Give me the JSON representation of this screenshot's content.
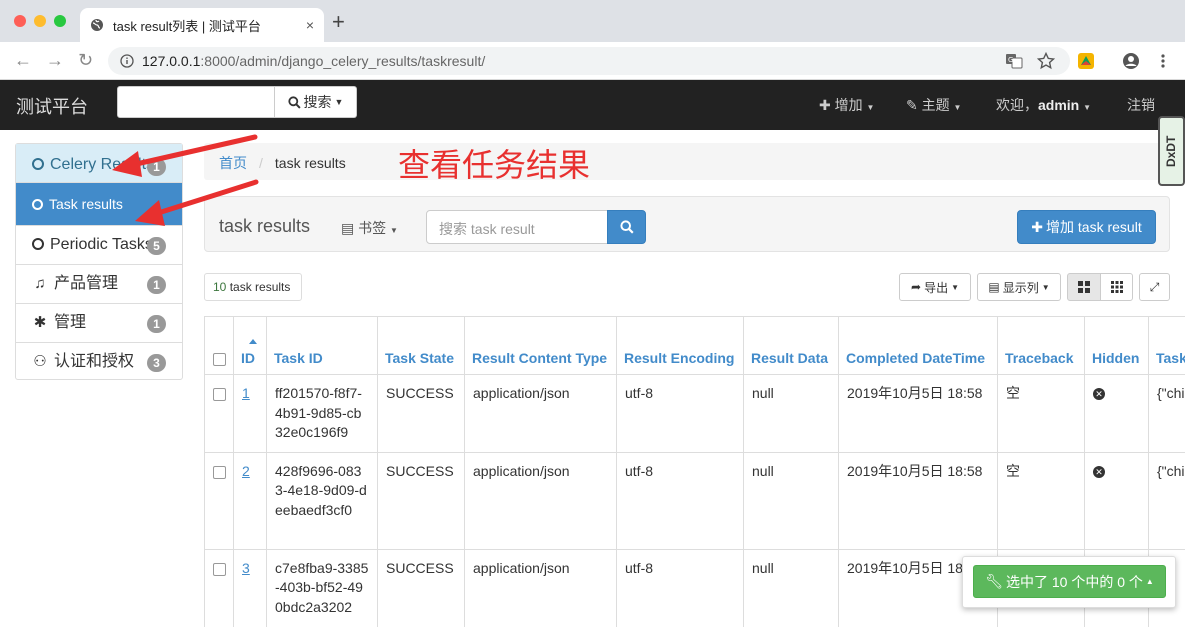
{
  "browser": {
    "tab_title": "task result列表 | 测试平台",
    "tab_close": "×",
    "new_tab": "+",
    "url_host": "127.0.0.1",
    "url_path": ":8000/admin/django_celery_results/taskresult/"
  },
  "navbar": {
    "brand": "测试平台",
    "search_label": "搜索",
    "add_menu": "增加",
    "theme_menu": "主题",
    "welcome": "欢迎，",
    "user": "admin",
    "logout": "注销"
  },
  "sidebar": {
    "items": [
      {
        "label": "Celery Results",
        "badge": "1"
      },
      {
        "label": "Task results"
      },
      {
        "label": "Periodic Tasks",
        "badge": "5"
      },
      {
        "label": "产品管理",
        "badge": "1"
      },
      {
        "label": "管理",
        "badge": "1"
      },
      {
        "label": "认证和授权",
        "badge": "3"
      }
    ]
  },
  "breadcrumb": {
    "home": "首页",
    "separator": "/",
    "current": "task results"
  },
  "annotation": "查看任务结果",
  "toolbar": {
    "title": "task results",
    "bookmark": "书签",
    "search_placeholder": "搜索 task result",
    "add_button": "增加 task result"
  },
  "list": {
    "count_number": "10",
    "count_suffix": " task results",
    "export": "导出",
    "columns_button": "显示列"
  },
  "table": {
    "headers": [
      "ID",
      "Task ID",
      "Task State",
      "Result Content Type",
      "Result Encoding",
      "Result Data",
      "Completed DateTime",
      "Traceback",
      "Hidden",
      "Task"
    ],
    "rows": [
      {
        "id": "1",
        "task_id": "ff201570-f8f7-4b91-9d85-cb32e0c196f9",
        "state": "SUCCESS",
        "content_type": "application/json",
        "encoding": "utf-8",
        "data": "null",
        "completed": "2019年10月5日 18:58",
        "traceback": "空",
        "task": "{\"chi"
      },
      {
        "id": "2",
        "task_id": "428f9696-0833-4e18-9d09-deebaedf3cf0",
        "state": "SUCCESS",
        "content_type": "application/json",
        "encoding": "utf-8",
        "data": "null",
        "completed": "2019年10月5日 18:58",
        "traceback": "空",
        "task": "{\"chi"
      },
      {
        "id": "3",
        "task_id": "c7e8fba9-3385-403b-bf52-490bdc2a3202",
        "state": "SUCCESS",
        "content_type": "application/json",
        "encoding": "utf-8",
        "data": "null",
        "completed": "2019年10月5日 18:58",
        "traceback": "",
        "task": ""
      }
    ]
  },
  "selection": {
    "label": "选中了 10 个中的 0 个"
  },
  "watermark": "DxDT"
}
